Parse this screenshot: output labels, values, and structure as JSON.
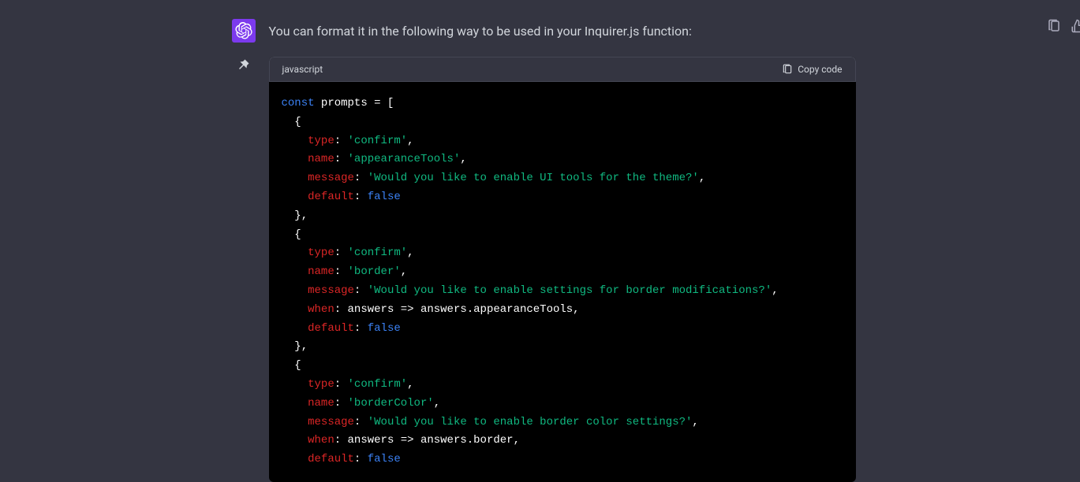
{
  "message": {
    "text": "You can format it in the following way to be used in your Inquirer.js function:"
  },
  "code": {
    "language": "javascript",
    "copy_label": "Copy code",
    "tokens": [
      {
        "t": "kw",
        "v": "const"
      },
      {
        "t": "sp",
        "v": " "
      },
      {
        "t": "id",
        "v": "prompts = ["
      },
      {
        "t": "nl"
      },
      {
        "t": "id",
        "v": "  {"
      },
      {
        "t": "nl"
      },
      {
        "t": "id",
        "v": "    "
      },
      {
        "t": "key",
        "v": "type"
      },
      {
        "t": "punct",
        "v": ": "
      },
      {
        "t": "str",
        "v": "'confirm'"
      },
      {
        "t": "punct",
        "v": ","
      },
      {
        "t": "nl"
      },
      {
        "t": "id",
        "v": "    "
      },
      {
        "t": "key",
        "v": "name"
      },
      {
        "t": "punct",
        "v": ": "
      },
      {
        "t": "str",
        "v": "'appearanceTools'"
      },
      {
        "t": "punct",
        "v": ","
      },
      {
        "t": "nl"
      },
      {
        "t": "id",
        "v": "    "
      },
      {
        "t": "key",
        "v": "message"
      },
      {
        "t": "punct",
        "v": ": "
      },
      {
        "t": "str",
        "v": "'Would you like to enable UI tools for the theme?'"
      },
      {
        "t": "punct",
        "v": ","
      },
      {
        "t": "nl"
      },
      {
        "t": "id",
        "v": "    "
      },
      {
        "t": "key",
        "v": "default"
      },
      {
        "t": "punct",
        "v": ": "
      },
      {
        "t": "bool",
        "v": "false"
      },
      {
        "t": "nl"
      },
      {
        "t": "id",
        "v": "  },"
      },
      {
        "t": "nl"
      },
      {
        "t": "id",
        "v": "  {"
      },
      {
        "t": "nl"
      },
      {
        "t": "id",
        "v": "    "
      },
      {
        "t": "key",
        "v": "type"
      },
      {
        "t": "punct",
        "v": ": "
      },
      {
        "t": "str",
        "v": "'confirm'"
      },
      {
        "t": "punct",
        "v": ","
      },
      {
        "t": "nl"
      },
      {
        "t": "id",
        "v": "    "
      },
      {
        "t": "key",
        "v": "name"
      },
      {
        "t": "punct",
        "v": ": "
      },
      {
        "t": "str",
        "v": "'border'"
      },
      {
        "t": "punct",
        "v": ","
      },
      {
        "t": "nl"
      },
      {
        "t": "id",
        "v": "    "
      },
      {
        "t": "key",
        "v": "message"
      },
      {
        "t": "punct",
        "v": ": "
      },
      {
        "t": "str",
        "v": "'Would you like to enable settings for border modifications?'"
      },
      {
        "t": "punct",
        "v": ","
      },
      {
        "t": "nl"
      },
      {
        "t": "id",
        "v": "    "
      },
      {
        "t": "key",
        "v": "when"
      },
      {
        "t": "punct",
        "v": ": "
      },
      {
        "t": "id",
        "v": "answers => answers.appearanceTools,"
      },
      {
        "t": "nl"
      },
      {
        "t": "id",
        "v": "    "
      },
      {
        "t": "key",
        "v": "default"
      },
      {
        "t": "punct",
        "v": ": "
      },
      {
        "t": "bool",
        "v": "false"
      },
      {
        "t": "nl"
      },
      {
        "t": "id",
        "v": "  },"
      },
      {
        "t": "nl"
      },
      {
        "t": "id",
        "v": "  {"
      },
      {
        "t": "nl"
      },
      {
        "t": "id",
        "v": "    "
      },
      {
        "t": "key",
        "v": "type"
      },
      {
        "t": "punct",
        "v": ": "
      },
      {
        "t": "str",
        "v": "'confirm'"
      },
      {
        "t": "punct",
        "v": ","
      },
      {
        "t": "nl"
      },
      {
        "t": "id",
        "v": "    "
      },
      {
        "t": "key",
        "v": "name"
      },
      {
        "t": "punct",
        "v": ": "
      },
      {
        "t": "str",
        "v": "'borderColor'"
      },
      {
        "t": "punct",
        "v": ","
      },
      {
        "t": "nl"
      },
      {
        "t": "id",
        "v": "    "
      },
      {
        "t": "key",
        "v": "message"
      },
      {
        "t": "punct",
        "v": ": "
      },
      {
        "t": "str",
        "v": "'Would you like to enable border color settings?'"
      },
      {
        "t": "punct",
        "v": ","
      },
      {
        "t": "nl"
      },
      {
        "t": "id",
        "v": "    "
      },
      {
        "t": "key",
        "v": "when"
      },
      {
        "t": "punct",
        "v": ": "
      },
      {
        "t": "id",
        "v": "answers => answers.border,"
      },
      {
        "t": "nl"
      },
      {
        "t": "id",
        "v": "    "
      },
      {
        "t": "key",
        "v": "default"
      },
      {
        "t": "punct",
        "v": ": "
      },
      {
        "t": "bool",
        "v": "false"
      }
    ]
  }
}
